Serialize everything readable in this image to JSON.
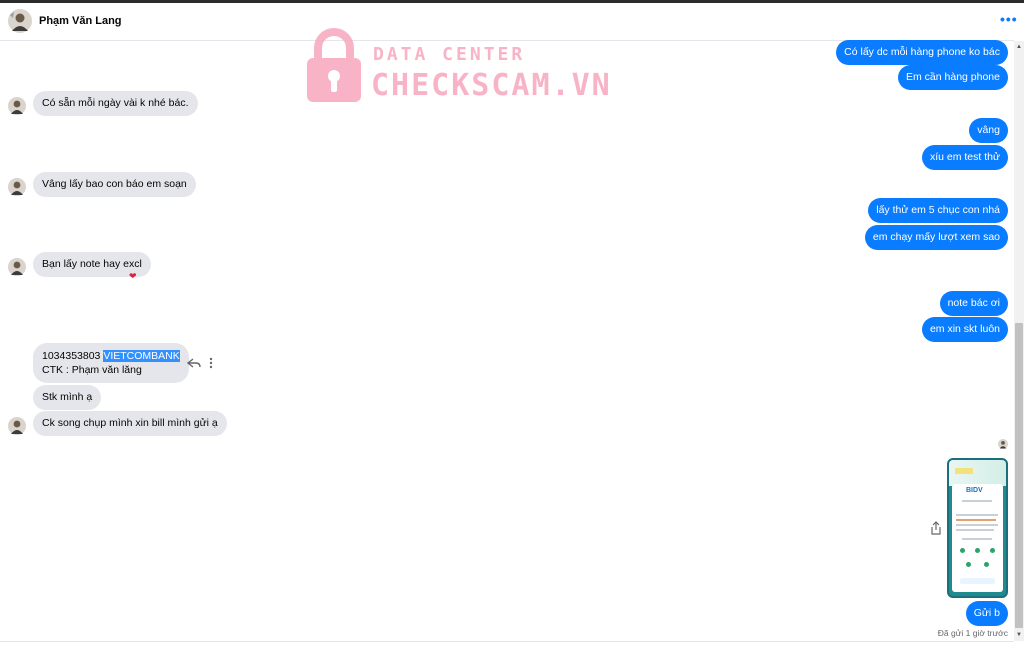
{
  "header": {
    "contact_name": "Phạm Văn Lang",
    "more_icon": "more-horizontal-icon"
  },
  "watermark": {
    "line1": "DATA CENTER",
    "line2": "CHECKSCAM.VN",
    "color": "#f7a8bd",
    "icon": "lock-icon"
  },
  "messages_out": {
    "m1": "Có lấy dc mỗi hàng phone ko bác",
    "m2": "Em cần hàng phone",
    "m3": "vâng",
    "m4": "xíu em test thử",
    "m5": "lấy thử em 5 chục con nhá",
    "m6": "em chạy mấy lượt xem sao",
    "m7": "note bác ơi",
    "m8": "em xin skt luôn",
    "m9": "Gửi b"
  },
  "messages_in": {
    "m1": "Có sẵn mỗi ngày vài k nhé bác.",
    "m2": "Vâng lấy bao con báo em soạn",
    "m3": "Bạn lấy note hay excl",
    "m4_line1": "1034353803 ",
    "m4_highlight": "VIETCOMBANK",
    "m4_line2": "CTK : Phạm văn lăng",
    "m5": "Stk mình ạ",
    "m6": "Ck song chụp mình xin bill mình gửi ạ"
  },
  "receipt": {
    "logo": "BIDV",
    "alt": "bank transfer receipt"
  },
  "status": {
    "sent": "Đã gửi 1 giờ trước"
  },
  "colors": {
    "outgoing": "#0a7cff",
    "incoming": "#e4e6eb",
    "reaction": "#e41e3f"
  }
}
